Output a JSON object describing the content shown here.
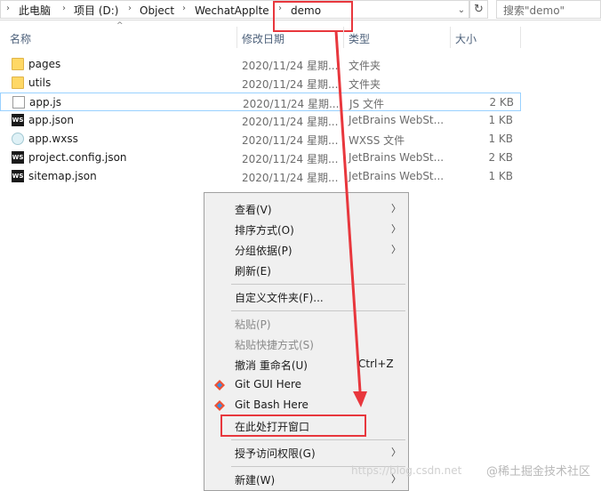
{
  "address_bar": {
    "crumbs": [
      "此电脑",
      "项目 (D:)",
      "Object",
      "WechatApplte",
      "demo"
    ],
    "search_placeholder": "搜索\"demo\""
  },
  "columns": {
    "name": "名称",
    "date": "修改日期",
    "type": "类型",
    "size": "大小"
  },
  "files": [
    {
      "name": "pages",
      "date": "2020/11/24 星期...",
      "type": "文件夹",
      "size": "",
      "icon": "folder-icon"
    },
    {
      "name": "utils",
      "date": "2020/11/24 星期...",
      "type": "文件夹",
      "size": "",
      "icon": "folder-icon"
    },
    {
      "name": "app.js",
      "date": "2020/11/24 星期...",
      "type": "JS 文件",
      "size": "2 KB",
      "icon": "js-file-icon",
      "selected": true
    },
    {
      "name": "app.json",
      "date": "2020/11/24 星期...",
      "type": "JetBrains WebSt...",
      "size": "1 KB",
      "icon": "webstorm-icon"
    },
    {
      "name": "app.wxss",
      "date": "2020/11/24 星期...",
      "type": "WXSS 文件",
      "size": "1 KB",
      "icon": "wxss-file-icon"
    },
    {
      "name": "project.config.json",
      "date": "2020/11/24 星期...",
      "type": "JetBrains WebSt...",
      "size": "2 KB",
      "icon": "webstorm-icon"
    },
    {
      "name": "sitemap.json",
      "date": "2020/11/24 星期...",
      "type": "JetBrains WebSt...",
      "size": "1 KB",
      "icon": "webstorm-icon"
    }
  ],
  "context_menu": {
    "items": [
      {
        "label": "查看(V)",
        "submenu": true
      },
      {
        "label": "排序方式(O)",
        "submenu": true
      },
      {
        "label": "分组依据(P)",
        "submenu": true
      },
      {
        "label": "刷新(E)"
      },
      {
        "label": "自定义文件夹(F)..."
      },
      {
        "label": "粘贴(P)",
        "disabled": true
      },
      {
        "label": "粘贴快捷方式(S)",
        "disabled": true
      },
      {
        "label": "撤消 重命名(U)",
        "shortcut": "Ctrl+Z"
      },
      {
        "label": "Git GUI Here",
        "icon": "git-icon"
      },
      {
        "label": "Git Bash Here",
        "icon": "git-icon"
      },
      {
        "label": "在此处打开窗口",
        "highlighted": true
      },
      {
        "label": "授予访问权限(G)",
        "submenu": true
      },
      {
        "label": "新建(W)",
        "submenu": true
      }
    ]
  },
  "watermark": "@稀土掘金技术社区",
  "watermark_url": "https://blog.csdn.net",
  "colors": {
    "annotation_red": "#e8373d",
    "selection_border": "#99d1ff",
    "menu_bg": "#f0f0f0"
  }
}
